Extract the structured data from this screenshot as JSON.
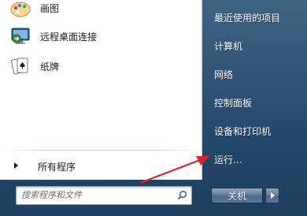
{
  "left_programs": [
    {
      "label": "画图",
      "icon": "paint-icon"
    },
    {
      "label": "远程桌面连接",
      "icon": "remote-desktop-icon"
    },
    {
      "label": "纸牌",
      "icon": "solitaire-icon"
    }
  ],
  "all_programs_label": "所有程序",
  "search": {
    "placeholder": "搜索程序和文件"
  },
  "right_items": [
    "最近使用的项目",
    "计算机",
    "网络",
    "控制面板",
    "设备和打印机",
    "运行..."
  ],
  "power_label": "关机",
  "colors": {
    "annotation_arrow": "#e0202a",
    "panel_bg": "#ffffff",
    "menu_bg": "#2b5172"
  }
}
